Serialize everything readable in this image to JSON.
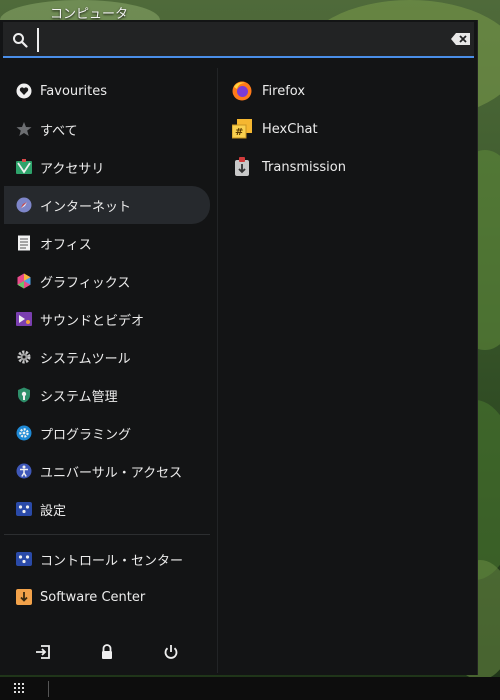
{
  "desktop": {
    "label": "コンピュータ"
  },
  "search": {
    "value": "",
    "placeholder": ""
  },
  "categories": [
    {
      "label": "Favourites",
      "icon": "heart-icon"
    },
    {
      "label": "すべて",
      "icon": "star-icon"
    },
    {
      "label": "アクセサリ",
      "icon": "accessories-icon"
    },
    {
      "label": "インターネット",
      "icon": "internet-icon",
      "active": true
    },
    {
      "label": "オフィス",
      "icon": "office-icon"
    },
    {
      "label": "グラフィックス",
      "icon": "graphics-icon"
    },
    {
      "label": "サウンドとビデオ",
      "icon": "multimedia-icon"
    },
    {
      "label": "システムツール",
      "icon": "system-tools-icon"
    },
    {
      "label": "システム管理",
      "icon": "system-admin-icon"
    },
    {
      "label": "プログラミング",
      "icon": "programming-icon"
    },
    {
      "label": "ユニバーサル・アクセス",
      "icon": "accessibility-icon"
    },
    {
      "label": "設定",
      "icon": "settings-icon"
    }
  ],
  "places": [
    {
      "label": "コントロール・センター",
      "icon": "control-center-icon"
    },
    {
      "label": "Software Center",
      "icon": "software-center-icon"
    }
  ],
  "apps": [
    {
      "label": "Firefox",
      "icon": "firefox-icon"
    },
    {
      "label": "HexChat",
      "icon": "hexchat-icon"
    },
    {
      "label": "Transmission",
      "icon": "transmission-icon"
    }
  ],
  "actions": {
    "logout_icon": "logout-icon",
    "lock_icon": "lock-icon",
    "power_icon": "power-icon"
  },
  "colors": {
    "accent": "#4a8ee8",
    "panel": "#131415",
    "active_row": "#26292d"
  }
}
